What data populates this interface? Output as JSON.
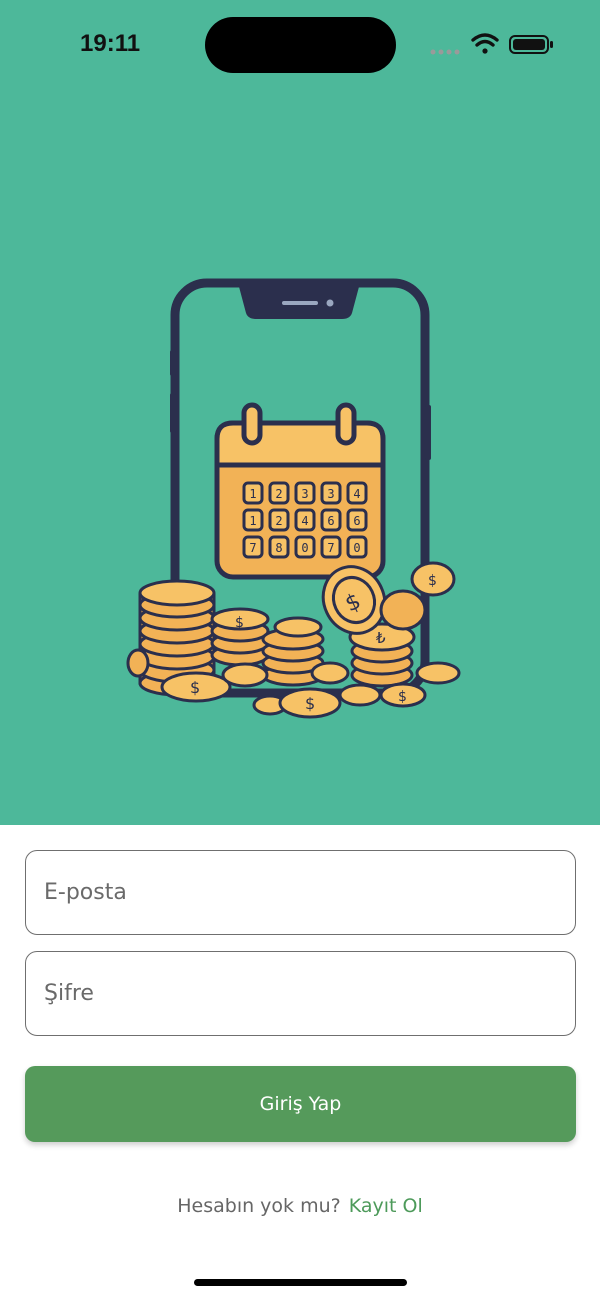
{
  "status_bar": {
    "time": "19:11",
    "icons": [
      "cellular-signal-icon",
      "wifi-icon",
      "battery-icon"
    ]
  },
  "hero": {
    "background_color": "#4db89a",
    "illustration": "phone-calendar-coins-illustration",
    "calendar_digits": [
      "1",
      "2",
      "3",
      "3",
      "4",
      "1",
      "2",
      "4",
      "6",
      "6",
      "7",
      "8",
      "0",
      "7",
      "0"
    ]
  },
  "form": {
    "email": {
      "placeholder": "E-posta",
      "value": ""
    },
    "password": {
      "placeholder": "Şifre",
      "value": ""
    },
    "login_button_label": "Giriş Yap",
    "login_button_color": "#559a5b"
  },
  "signup": {
    "prompt": "Hesabın yok mu?",
    "link_label": "Kayıt Ol",
    "link_color": "#4d9a5a"
  }
}
